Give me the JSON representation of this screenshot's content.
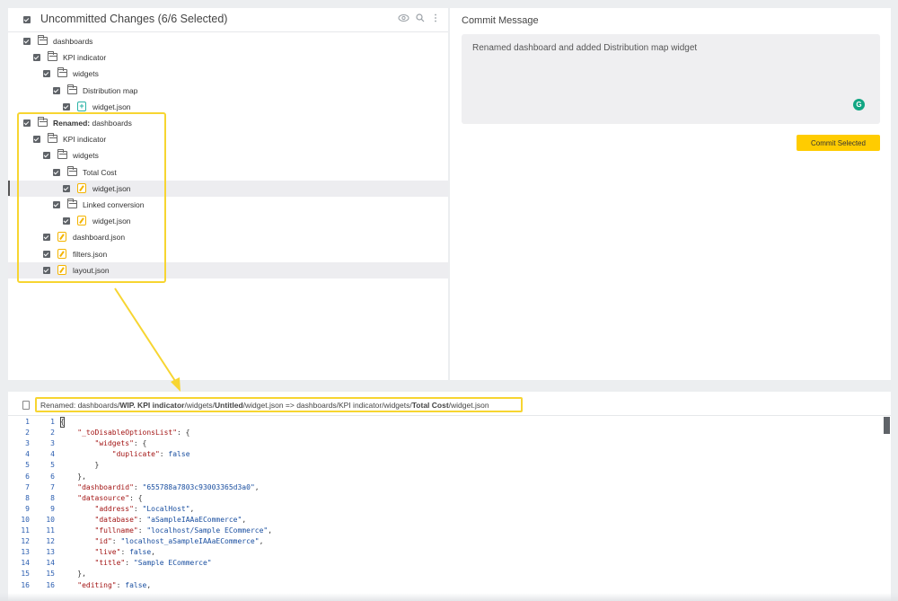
{
  "changes": {
    "title": "Uncommitted Changes (6/6 Selected)",
    "tree": [
      {
        "label": "dashboards",
        "prefix": "",
        "icon": "folder",
        "highlight": false
      },
      {
        "label": "KPI indicator",
        "prefix": "",
        "icon": "folder",
        "highlight": false
      },
      {
        "label": "widgets",
        "prefix": "",
        "icon": "folder",
        "highlight": false
      },
      {
        "label": "Distribution map",
        "prefix": "",
        "icon": "folder",
        "highlight": false
      },
      {
        "label": "widget.json",
        "prefix": "",
        "icon": "file-added",
        "highlight": false
      },
      {
        "label": "dashboards",
        "prefix": "Renamed:",
        "icon": "folder",
        "highlight": false
      },
      {
        "label": "KPI indicator",
        "prefix": "",
        "icon": "folder",
        "highlight": false
      },
      {
        "label": "widgets",
        "prefix": "",
        "icon": "folder",
        "highlight": false
      },
      {
        "label": "Total Cost",
        "prefix": "",
        "icon": "folder",
        "highlight": false
      },
      {
        "label": "widget.json",
        "prefix": "",
        "icon": "file-modified",
        "highlight": true
      },
      {
        "label": "Linked conversion",
        "prefix": "",
        "icon": "folder",
        "highlight": false
      },
      {
        "label": "widget.json",
        "prefix": "",
        "icon": "file-modified",
        "highlight": false
      },
      {
        "label": "dashboard.json",
        "prefix": "",
        "icon": "file-modified",
        "highlight": false
      },
      {
        "label": "filters.json",
        "prefix": "",
        "icon": "file-modified",
        "highlight": false
      },
      {
        "label": "layout.json",
        "prefix": "",
        "icon": "file-modified",
        "highlight": true
      }
    ]
  },
  "commit": {
    "title": "Commit Message",
    "message": "Renamed dashboard and added Distribution map widget",
    "button_label": "Commit Selected"
  },
  "diff": {
    "file_path_parts": [
      {
        "text": "Renamed: dashboards/",
        "bold": false
      },
      {
        "text": "WIP. KPI indicator",
        "bold": true
      },
      {
        "text": "/widgets/",
        "bold": false
      },
      {
        "text": "Untitled",
        "bold": true
      },
      {
        "text": "/widget.json => dashboards/KPI indicator/widgets/",
        "bold": false
      },
      {
        "text": "Total Cost",
        "bold": true
      },
      {
        "text": "/widget.json",
        "bold": false
      }
    ],
    "lines": [
      {
        "n1": "1",
        "n2": "1",
        "text": "{"
      },
      {
        "n1": "2",
        "n2": "2",
        "text": "    \"_toDisableOptionsList\": {"
      },
      {
        "n1": "3",
        "n2": "3",
        "text": "        \"widgets\": {"
      },
      {
        "n1": "4",
        "n2": "4",
        "text": "            \"duplicate\": false"
      },
      {
        "n1": "5",
        "n2": "5",
        "text": "        }"
      },
      {
        "n1": "6",
        "n2": "6",
        "text": "    },"
      },
      {
        "n1": "7",
        "n2": "7",
        "text": "    \"dashboardid\": \"655788a7803c93003365d3a0\","
      },
      {
        "n1": "8",
        "n2": "8",
        "text": "    \"datasource\": {"
      },
      {
        "n1": "9",
        "n2": "9",
        "text": "        \"address\": \"LocalHost\","
      },
      {
        "n1": "10",
        "n2": "10",
        "text": "        \"database\": \"aSampleIAAaECommerce\","
      },
      {
        "n1": "11",
        "n2": "11",
        "text": "        \"fullname\": \"localhost/Sample ECommerce\","
      },
      {
        "n1": "12",
        "n2": "12",
        "text": "        \"id\": \"localhost_aSampleIAAaECommerce\","
      },
      {
        "n1": "13",
        "n2": "13",
        "text": "        \"live\": false,"
      },
      {
        "n1": "14",
        "n2": "14",
        "text": "        \"title\": \"Sample ECommerce\""
      },
      {
        "n1": "15",
        "n2": "15",
        "text": "    },"
      },
      {
        "n1": "16",
        "n2": "16",
        "text": "    \"editing\": false,"
      }
    ]
  },
  "colors": {
    "accent_yellow": "#ffcc01",
    "highlight_outline": "#f7d531",
    "modified_file": "#f4b400",
    "added_file": "#2bb3a6"
  },
  "icons": {
    "visibility": "eye-icon",
    "search": "search-icon",
    "more": "more-vertical-icon",
    "grammarly": "grammarly-icon"
  }
}
